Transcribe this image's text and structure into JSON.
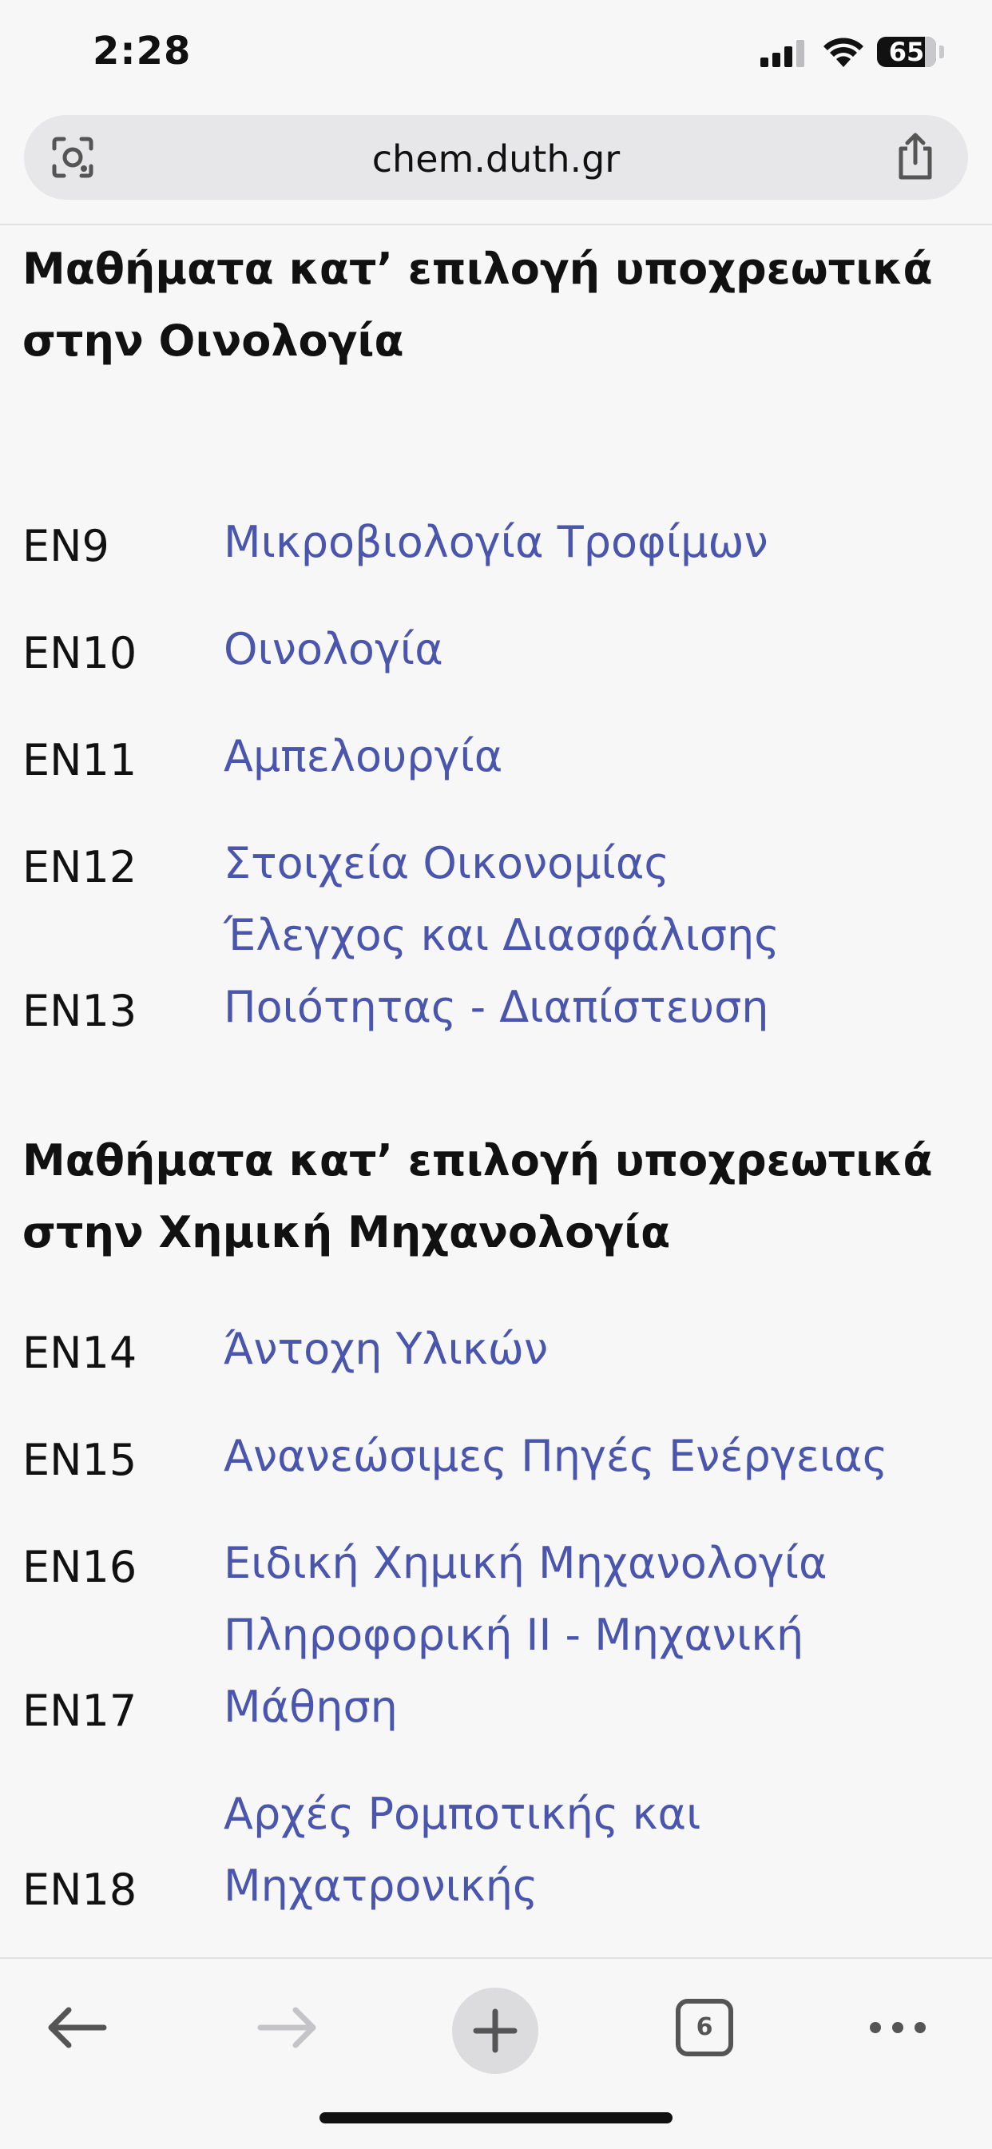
{
  "status_bar": {
    "time": "2:28",
    "battery": "65"
  },
  "browser": {
    "url": "chem.duth.gr",
    "tab_count": "6"
  },
  "sections": [
    {
      "title": "Μαθήματα κατ’ επιλογή υποχρεωτικά στην Οινολογία",
      "courses": [
        {
          "code": "EN9",
          "name": "Μικροβιολογία Τροφίμων"
        },
        {
          "code": "EN10",
          "name": "Οινολογία"
        },
        {
          "code": "EN11",
          "name": "Αμπελουργία"
        },
        {
          "code": "EN12",
          "name": "Στοιχεία Οικονομίας"
        },
        {
          "code": "EN13",
          "name": "Έλεγχος και Διασφάλισης Ποιότητας - Διαπίστευση"
        }
      ]
    },
    {
      "title": "Μαθήματα κατ’ επιλογή υποχρεωτικά στην Χημική Μηχανολογία",
      "courses": [
        {
          "code": "EN14",
          "name": "Άντοχη Υλικών"
        },
        {
          "code": "EN15",
          "name": "Ανανεώσιμες Πηγές Ενέργειας"
        },
        {
          "code": "EN16",
          "name": "Ειδική Χημική Μηχανολογία"
        },
        {
          "code": "EN17",
          "name": "Πληροφορική ΙΙ - Μηχανική Μάθηση"
        },
        {
          "code": "EN18",
          "name": "Αρχές Ρομποτικής και Μηχατρονικής"
        }
      ]
    }
  ],
  "colors": {
    "link": "#4a56ad",
    "background": "#f7f7f8"
  },
  "icons": [
    "lens-icon",
    "share-icon",
    "back-icon",
    "forward-icon",
    "plus-icon",
    "tabs-icon",
    "more-icon"
  ]
}
